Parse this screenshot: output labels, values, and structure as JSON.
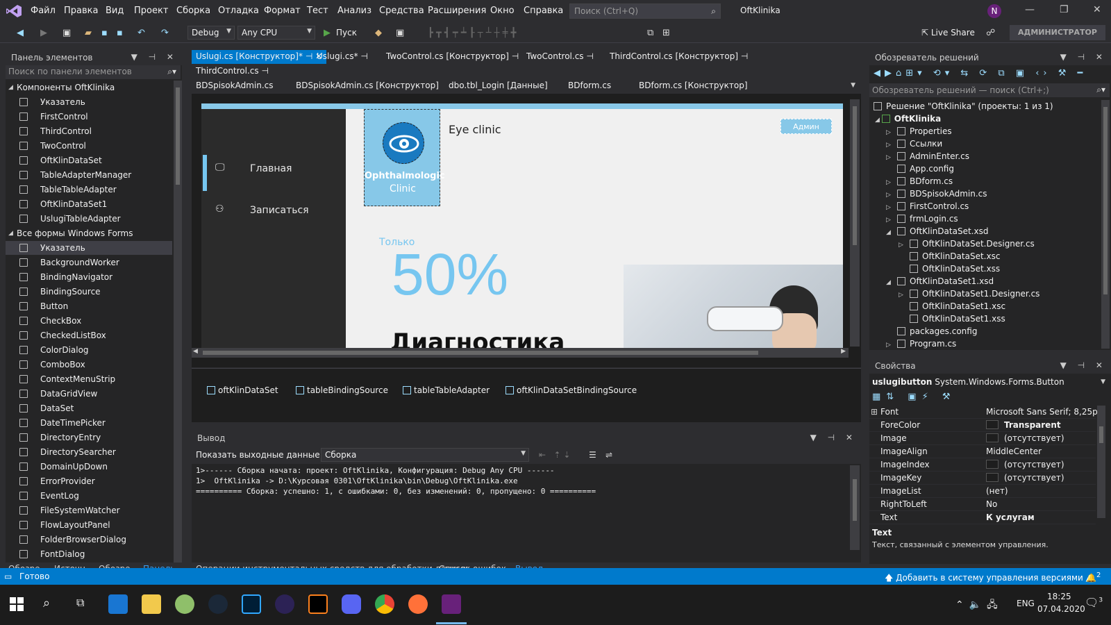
{
  "menubar": {
    "items": [
      "Файл",
      "Правка",
      "Вид",
      "Проект",
      "Сборка",
      "Отладка",
      "Формат",
      "Тест",
      "Анализ",
      "Средства",
      "Расширения",
      "Окно",
      "Справка"
    ],
    "search_placeholder": "Поиск (Ctrl+Q)",
    "solution_name": "OftKlinika",
    "avatar": "N"
  },
  "toolbar": {
    "config": "Debug",
    "platform": "Any CPU",
    "run_label": "Пуск",
    "live_share": "Live Share",
    "admin": "АДМИНИСТРАТОР"
  },
  "toolbox": {
    "title": "Панель элементов",
    "search_placeholder": "Поиск по панели элементов",
    "cat1": "Компоненты OftKlinika",
    "cat1_items": [
      "Указатель",
      "FirstControl",
      "ThirdControl",
      "TwoControl",
      "OftKlinDataSet",
      "TableAdapterManager",
      "TableTableAdapter",
      "OftKlinDataSet1",
      "UslugiTableAdapter"
    ],
    "cat2": "Все формы Windows Forms",
    "cat2_items": [
      "Указатель",
      "BackgroundWorker",
      "BindingNavigator",
      "BindingSource",
      "Button",
      "CheckBox",
      "CheckedListBox",
      "ColorDialog",
      "ComboBox",
      "ContextMenuStrip",
      "DataGridView",
      "DataSet",
      "DateTimePicker",
      "DirectoryEntry",
      "DirectorySearcher",
      "DomainUpDown",
      "ErrorProvider",
      "EventLog",
      "FileSystemWatcher",
      "FlowLayoutPanel",
      "FolderBrowserDialog",
      "FontDialog"
    ]
  },
  "left_bottom_tabs": [
    "Обозре...",
    "Источн...",
    "Обозре...",
    "Панель..."
  ],
  "doc_tabs": {
    "row1": [
      "Uslugi.cs [Конструктор]*",
      "Uslugi.cs*",
      "TwoControl.cs [Конструктор]",
      "TwoControl.cs",
      "ThirdControl.cs [Конструктор]"
    ],
    "row1b": [
      "ThirdControl.cs"
    ],
    "row2": [
      "BDSpisokAdmin.cs",
      "BDSpisokAdmin.cs [Конструктор]",
      "dbo.tbl_Login [Данные]",
      "BDform.cs",
      "BDform.cs [Конструктор]"
    ]
  },
  "form": {
    "nav": [
      "Главная",
      "Записаться"
    ],
    "logo_t1": "Ophthalmologic",
    "logo_t2": "Clinic",
    "title": "Eye clinic",
    "admin_btn": "Админ",
    "only": "Только",
    "percent": "50%",
    "diag": "Диагностика"
  },
  "tray": [
    "oftKlinDataSet",
    "tableBindingSource",
    "tableTableAdapter",
    "oftKlinDataSetBindingSource"
  ],
  "output": {
    "title": "Вывод",
    "source_label": "Показать выходные данные из:",
    "source_value": "Сборка",
    "lines": "1>------ Сборка начата: проект: OftKlinika, Конфигурация: Debug Any CPU ------\n1>  OftKlinika -> D:\\Курсовая 0301\\OftKlinika\\bin\\Debug\\OftKlinika.exe\n========== Сборка: успешно: 1, с ошибками: 0, без изменений: 0, пропущено: 0 =========="
  },
  "center_bottom_tabs": [
    "Операции инструментальных средств для обработки данных",
    "Список ошибок...",
    "Вывод"
  ],
  "solution": {
    "title": "Обозреватель решений",
    "search_placeholder": "Обозреватель решений — поиск (Ctrl+;)",
    "root": "Решение \"OftKlinika\" (проекты: 1 из 1)",
    "project": "OftKlinika",
    "items": [
      {
        "label": "Properties",
        "level": 2,
        "exp": "▷"
      },
      {
        "label": "Ссылки",
        "level": 2,
        "exp": "▷"
      },
      {
        "label": "AdminEnter.cs",
        "level": 2,
        "exp": "▷"
      },
      {
        "label": "App.config",
        "level": 2,
        "exp": ""
      },
      {
        "label": "BDform.cs",
        "level": 2,
        "exp": "▷"
      },
      {
        "label": "BDSpisokAdmin.cs",
        "level": 2,
        "exp": "▷"
      },
      {
        "label": "FirstControl.cs",
        "level": 2,
        "exp": "▷"
      },
      {
        "label": "frmLogin.cs",
        "level": 2,
        "exp": "▷"
      },
      {
        "label": "OftKlinDataSet.xsd",
        "level": 2,
        "exp": "◢"
      },
      {
        "label": "OftKlinDataSet.Designer.cs",
        "level": 3,
        "exp": "▷"
      },
      {
        "label": "OftKlinDataSet.xsc",
        "level": 3,
        "exp": ""
      },
      {
        "label": "OftKlinDataSet.xss",
        "level": 3,
        "exp": ""
      },
      {
        "label": "OftKlinDataSet1.xsd",
        "level": 2,
        "exp": "◢"
      },
      {
        "label": "OftKlinDataSet1.Designer.cs",
        "level": 3,
        "exp": "▷"
      },
      {
        "label": "OftKlinDataSet1.xsc",
        "level": 3,
        "exp": ""
      },
      {
        "label": "OftKlinDataSet1.xss",
        "level": 3,
        "exp": ""
      },
      {
        "label": "packages.config",
        "level": 2,
        "exp": ""
      },
      {
        "label": "Program.cs",
        "level": 2,
        "exp": "▷"
      }
    ]
  },
  "properties": {
    "title": "Свойства",
    "object_name": "uslugibutton",
    "object_type": "System.Windows.Forms.Button",
    "rows": [
      {
        "name": "Font",
        "value": "Microsoft Sans Serif; 8,25pt",
        "swatch": false,
        "bold": false
      },
      {
        "name": "ForeColor",
        "value": "Transparent",
        "swatch": true,
        "bold": true
      },
      {
        "name": "Image",
        "value": "(отсутствует)",
        "swatch": true,
        "bold": false
      },
      {
        "name": "ImageAlign",
        "value": "MiddleCenter",
        "swatch": false,
        "bold": false
      },
      {
        "name": "ImageIndex",
        "value": "(отсутствует)",
        "swatch": true,
        "bold": false
      },
      {
        "name": "ImageKey",
        "value": "(отсутствует)",
        "swatch": true,
        "bold": false
      },
      {
        "name": "ImageList",
        "value": "(нет)",
        "swatch": false,
        "bold": false
      },
      {
        "name": "RightToLeft",
        "value": "No",
        "swatch": false,
        "bold": false
      },
      {
        "name": "Text",
        "value": "К услугам",
        "swatch": false,
        "bold": true
      }
    ],
    "desc_title": "Text",
    "desc_text": "Текст, связанный с элементом управления."
  },
  "status": {
    "ready": "Готово",
    "vcs": "Добавить в систему управления версиями",
    "notif": "2"
  },
  "taskbar": {
    "lang": "ENG",
    "time": "18:25",
    "date": "07.04.2020",
    "notif": "3"
  }
}
